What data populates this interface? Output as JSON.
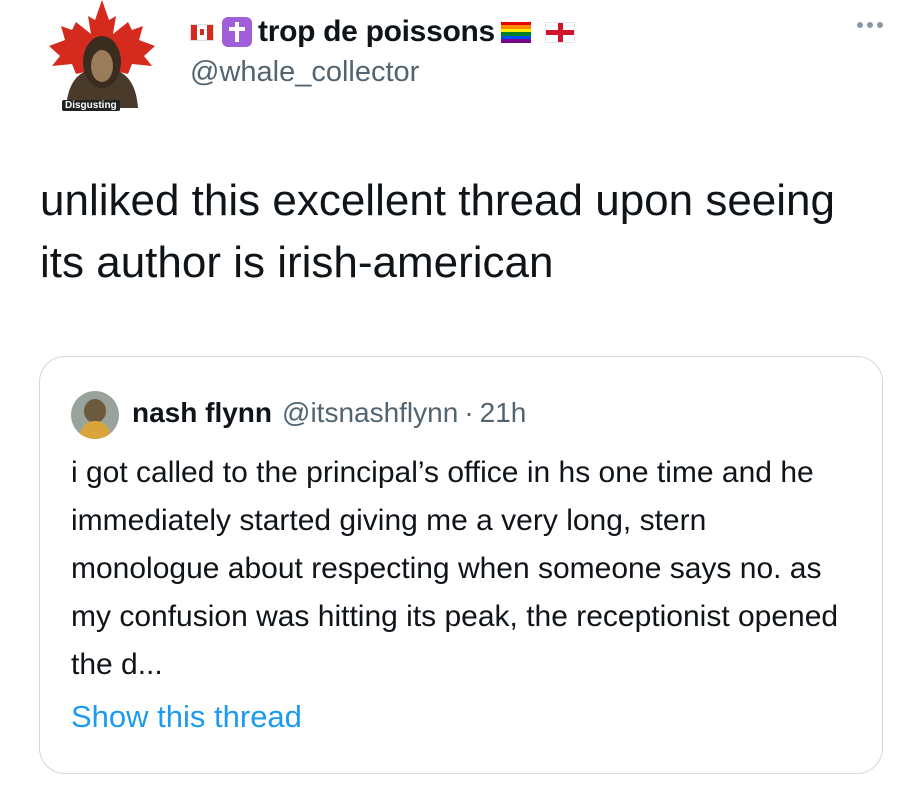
{
  "author": {
    "display_name": "trop de poissons",
    "handle": "@whale_collector",
    "avatar_caption": "Disgusting",
    "name_emoji": [
      "canada-flag",
      "latin-cross",
      "rainbow-flag",
      "england-flag"
    ]
  },
  "more_icon": "more-horizontal-icon",
  "tweet": {
    "text": "unliked this excellent thread upon seeing its author is irish-american"
  },
  "quoted_tweet": {
    "display_name": "nash flynn",
    "handle": "@itsnashflynn",
    "separator": "·",
    "time": "21h",
    "text": "i got called to the principal’s office in hs one time and he immediately started giving me a very long, stern monologue about respecting when someone says no. as my confusion was hitting its peak, the receptionist opened the d...",
    "show_thread_label": "Show this thread"
  },
  "colors": {
    "link": "#1d9bf0",
    "secondary_text": "#536471",
    "border": "#cfd9de",
    "maple_leaf": "#d52b1e"
  }
}
